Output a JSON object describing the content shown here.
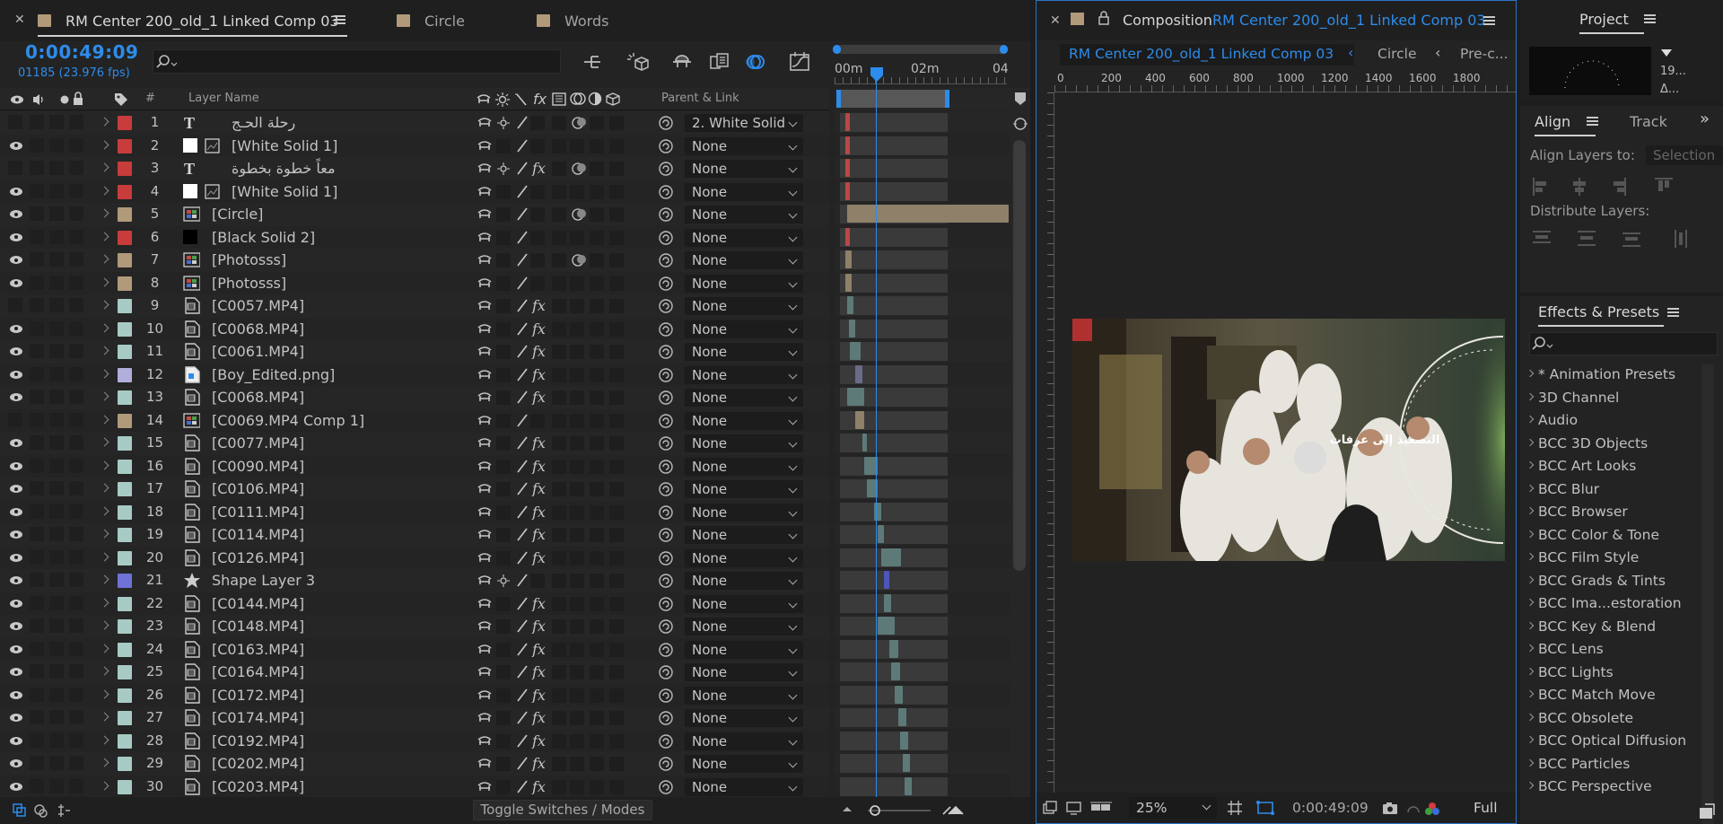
{
  "timeline": {
    "tabs": [
      {
        "label": "RM Center 200_old_1 Linked Comp 03",
        "color": "#b09a7a",
        "active": true
      },
      {
        "label": "Circle",
        "color": "#b09a7a",
        "active": false
      },
      {
        "label": "Words",
        "color": "#b09a7a",
        "active": false
      }
    ],
    "current_time": "0:00:49:09",
    "frame_fps": "01185 (23.976 fps)",
    "search_placeholder": "",
    "columns": {
      "hash": "#",
      "layer_name": "Layer Name",
      "parent_link": "Parent & Link"
    },
    "ruler": {
      "m0": "00m",
      "m2": "02m",
      "m4": "04"
    },
    "toggle_label": "Toggle Switches / Modes",
    "layers": [
      {
        "num": "1",
        "name": "رحلة الحـج",
        "type": "text",
        "label": "#c83c3c",
        "parent": "2. White Solid",
        "eye": false,
        "bar_start": 0.03,
        "bar_end": 0.06,
        "bar_color": "#b84848"
      },
      {
        "num": "2",
        "name": "[White Solid 1]",
        "type": "solid-white",
        "label": "#c83c3c",
        "parent": "None",
        "eye": true,
        "bar_start": 0.03,
        "bar_end": 0.06,
        "bar_color": "#b84848"
      },
      {
        "num": "3",
        "name": "معاً خطوة بخطوة",
        "type": "text",
        "label": "#c83c3c",
        "parent": "None",
        "eye": false,
        "bar_start": 0.03,
        "bar_end": 0.06,
        "bar_color": "#b84848"
      },
      {
        "num": "4",
        "name": "[White Solid 1]",
        "type": "solid-white",
        "label": "#c83c3c",
        "parent": "None",
        "eye": true,
        "bar_start": 0.03,
        "bar_end": 0.06,
        "bar_color": "#b84848"
      },
      {
        "num": "5",
        "name": "[Circle]",
        "type": "comp",
        "label": "#b09a7a",
        "parent": "None",
        "eye": true,
        "bar_start": 0.04,
        "bar_end": 0.99,
        "bar_color": "#8f8069"
      },
      {
        "num": "6",
        "name": "[Black Solid 2]",
        "type": "solid-black",
        "label": "#c83c3c",
        "parent": "None",
        "eye": true,
        "bar_start": 0.03,
        "bar_end": 0.06,
        "bar_color": "#b84848"
      },
      {
        "num": "7",
        "name": "[Photosss]",
        "type": "comp",
        "label": "#b09a7a",
        "parent": "None",
        "eye": true,
        "bar_start": 0.03,
        "bar_end": 0.07,
        "bar_color": "#8f8069"
      },
      {
        "num": "8",
        "name": "[Photosss]",
        "type": "comp",
        "label": "#b09a7a",
        "parent": "None",
        "eye": true,
        "bar_start": 0.03,
        "bar_end": 0.07,
        "bar_color": "#8f8069"
      },
      {
        "num": "9",
        "name": "[C0057.MP4]",
        "type": "footage",
        "label": "#a7cbc4",
        "parent": "None",
        "eye": false,
        "bar_start": 0.04,
        "bar_end": 0.08,
        "bar_color": "#5d7a78"
      },
      {
        "num": "10",
        "name": "[C0068.MP4]",
        "type": "footage",
        "label": "#a7cbc4",
        "parent": "None",
        "eye": true,
        "bar_start": 0.05,
        "bar_end": 0.09,
        "bar_color": "#5d7a78"
      },
      {
        "num": "11",
        "name": "[C0061.MP4]",
        "type": "footage",
        "label": "#a7cbc4",
        "parent": "None",
        "eye": true,
        "bar_start": 0.06,
        "bar_end": 0.12,
        "bar_color": "#5d7a78"
      },
      {
        "num": "12",
        "name": "[Boy_Edited.png]",
        "type": "image",
        "label": "#b1aedb",
        "parent": "None",
        "eye": true,
        "bar_start": 0.09,
        "bar_end": 0.13,
        "bar_color": "#6a6a8a"
      },
      {
        "num": "13",
        "name": "[C0068.MP4]",
        "type": "footage",
        "label": "#a7cbc4",
        "parent": "None",
        "eye": true,
        "bar_start": 0.04,
        "bar_end": 0.14,
        "bar_color": "#5d7a78"
      },
      {
        "num": "14",
        "name": "[C0069.MP4 Comp 1]",
        "type": "comp",
        "label": "#b09a7a",
        "parent": "None",
        "eye": false,
        "bar_start": 0.09,
        "bar_end": 0.14,
        "bar_color": "#8f8069"
      },
      {
        "num": "15",
        "name": "[C0077.MP4]",
        "type": "footage",
        "label": "#a7cbc4",
        "parent": "None",
        "eye": true,
        "bar_start": 0.13,
        "bar_end": 0.16,
        "bar_color": "#5d7a78"
      },
      {
        "num": "16",
        "name": "[C0090.MP4]",
        "type": "footage",
        "label": "#a7cbc4",
        "parent": "None",
        "eye": true,
        "bar_start": 0.14,
        "bar_end": 0.22,
        "bar_color": "#5d7a78"
      },
      {
        "num": "17",
        "name": "[C0106.MP4]",
        "type": "footage",
        "label": "#a7cbc4",
        "parent": "None",
        "eye": true,
        "bar_start": 0.16,
        "bar_end": 0.22,
        "bar_color": "#5d7a78"
      },
      {
        "num": "18",
        "name": "[C0111.MP4]",
        "type": "footage",
        "label": "#a7cbc4",
        "parent": "None",
        "eye": true,
        "bar_start": 0.2,
        "bar_end": 0.24,
        "bar_color": "#5d7a78"
      },
      {
        "num": "19",
        "name": "[C0114.MP4]",
        "type": "footage",
        "label": "#a7cbc4",
        "parent": "None",
        "eye": true,
        "bar_start": 0.22,
        "bar_end": 0.26,
        "bar_color": "#5d7a78"
      },
      {
        "num": "20",
        "name": "[C0126.MP4]",
        "type": "footage",
        "label": "#a7cbc4",
        "parent": "None",
        "eye": true,
        "bar_start": 0.24,
        "bar_end": 0.36,
        "bar_color": "#5d7a78"
      },
      {
        "num": "21",
        "name": "Shape Layer 3",
        "type": "shape",
        "label": "#6f72d6",
        "parent": "None",
        "eye": true,
        "bar_start": 0.26,
        "bar_end": 0.29,
        "bar_color": "#4e56b8"
      },
      {
        "num": "22",
        "name": "[C0144.MP4]",
        "type": "footage",
        "label": "#a7cbc4",
        "parent": "None",
        "eye": true,
        "bar_start": 0.26,
        "bar_end": 0.3,
        "bar_color": "#5d7a78"
      },
      {
        "num": "23",
        "name": "[C0148.MP4]",
        "type": "footage",
        "label": "#a7cbc4",
        "parent": "None",
        "eye": true,
        "bar_start": 0.22,
        "bar_end": 0.32,
        "bar_color": "#5d7a78"
      },
      {
        "num": "24",
        "name": "[C0163.MP4]",
        "type": "footage",
        "label": "#a7cbc4",
        "parent": "None",
        "eye": true,
        "bar_start": 0.29,
        "bar_end": 0.34,
        "bar_color": "#5d7a78"
      },
      {
        "num": "25",
        "name": "[C0164.MP4]",
        "type": "footage",
        "label": "#a7cbc4",
        "parent": "None",
        "eye": true,
        "bar_start": 0.3,
        "bar_end": 0.35,
        "bar_color": "#5d7a78"
      },
      {
        "num": "26",
        "name": "[C0172.MP4]",
        "type": "footage",
        "label": "#a7cbc4",
        "parent": "None",
        "eye": true,
        "bar_start": 0.32,
        "bar_end": 0.37,
        "bar_color": "#5d7a78"
      },
      {
        "num": "27",
        "name": "[C0174.MP4]",
        "type": "footage",
        "label": "#a7cbc4",
        "parent": "None",
        "eye": true,
        "bar_start": 0.34,
        "bar_end": 0.39,
        "bar_color": "#5d7a78"
      },
      {
        "num": "28",
        "name": "[C0192.MP4]",
        "type": "footage",
        "label": "#a7cbc4",
        "parent": "None",
        "eye": true,
        "bar_start": 0.35,
        "bar_end": 0.4,
        "bar_color": "#5d7a78"
      },
      {
        "num": "29",
        "name": "[C0202.MP4]",
        "type": "footage",
        "label": "#a7cbc4",
        "parent": "None",
        "eye": true,
        "bar_start": 0.37,
        "bar_end": 0.41,
        "bar_color": "#5d7a78"
      },
      {
        "num": "30",
        "name": "[C0203.MP4]",
        "type": "footage",
        "label": "#a7cbc4",
        "parent": "None",
        "eye": true,
        "bar_start": 0.38,
        "bar_end": 0.42,
        "bar_color": "#5d7a78"
      }
    ]
  },
  "composition": {
    "panel_label": "Composition",
    "comp_name": "RM Center 200_old_1 Linked Comp 03",
    "flow": [
      "RM Center 200_old_1 Linked Comp 03",
      "Circle",
      "Pre-c..."
    ],
    "ruler_marks": [
      "0",
      "200",
      "400",
      "600",
      "800",
      "1000",
      "1200",
      "1400",
      "1600",
      "1800"
    ],
    "caption": "التصعيد إلى عرفات",
    "zoom": "25%",
    "timecode": "0:00:49:09",
    "resolution": "Full"
  },
  "project": {
    "title": "Project",
    "info_lines": [
      "19...",
      "Δ..."
    ]
  },
  "align": {
    "tab_align": "Align",
    "tab_tracker": "Track",
    "align_to_label": "Align Layers to:",
    "align_to_value": "Selection",
    "distribute_label": "Distribute Layers:"
  },
  "effects": {
    "title": "Effects & Presets",
    "search_placeholder": "",
    "items": [
      "* Animation Presets",
      "3D Channel",
      "Audio",
      "BCC 3D Objects",
      "BCC Art Looks",
      "BCC Blur",
      "BCC Browser",
      "BCC Color & Tone",
      "BCC Film Style",
      "BCC Grads & Tints",
      "BCC Ima...estoration",
      "BCC Key & Blend",
      "BCC Lens",
      "BCC Lights",
      "BCC Match Move",
      "BCC Obsolete",
      "BCC Optical Diffusion",
      "BCC Particles",
      "BCC Perspective"
    ]
  },
  "colors": {
    "accent": "#2d8ceb",
    "panel_bg": "#232323"
  }
}
